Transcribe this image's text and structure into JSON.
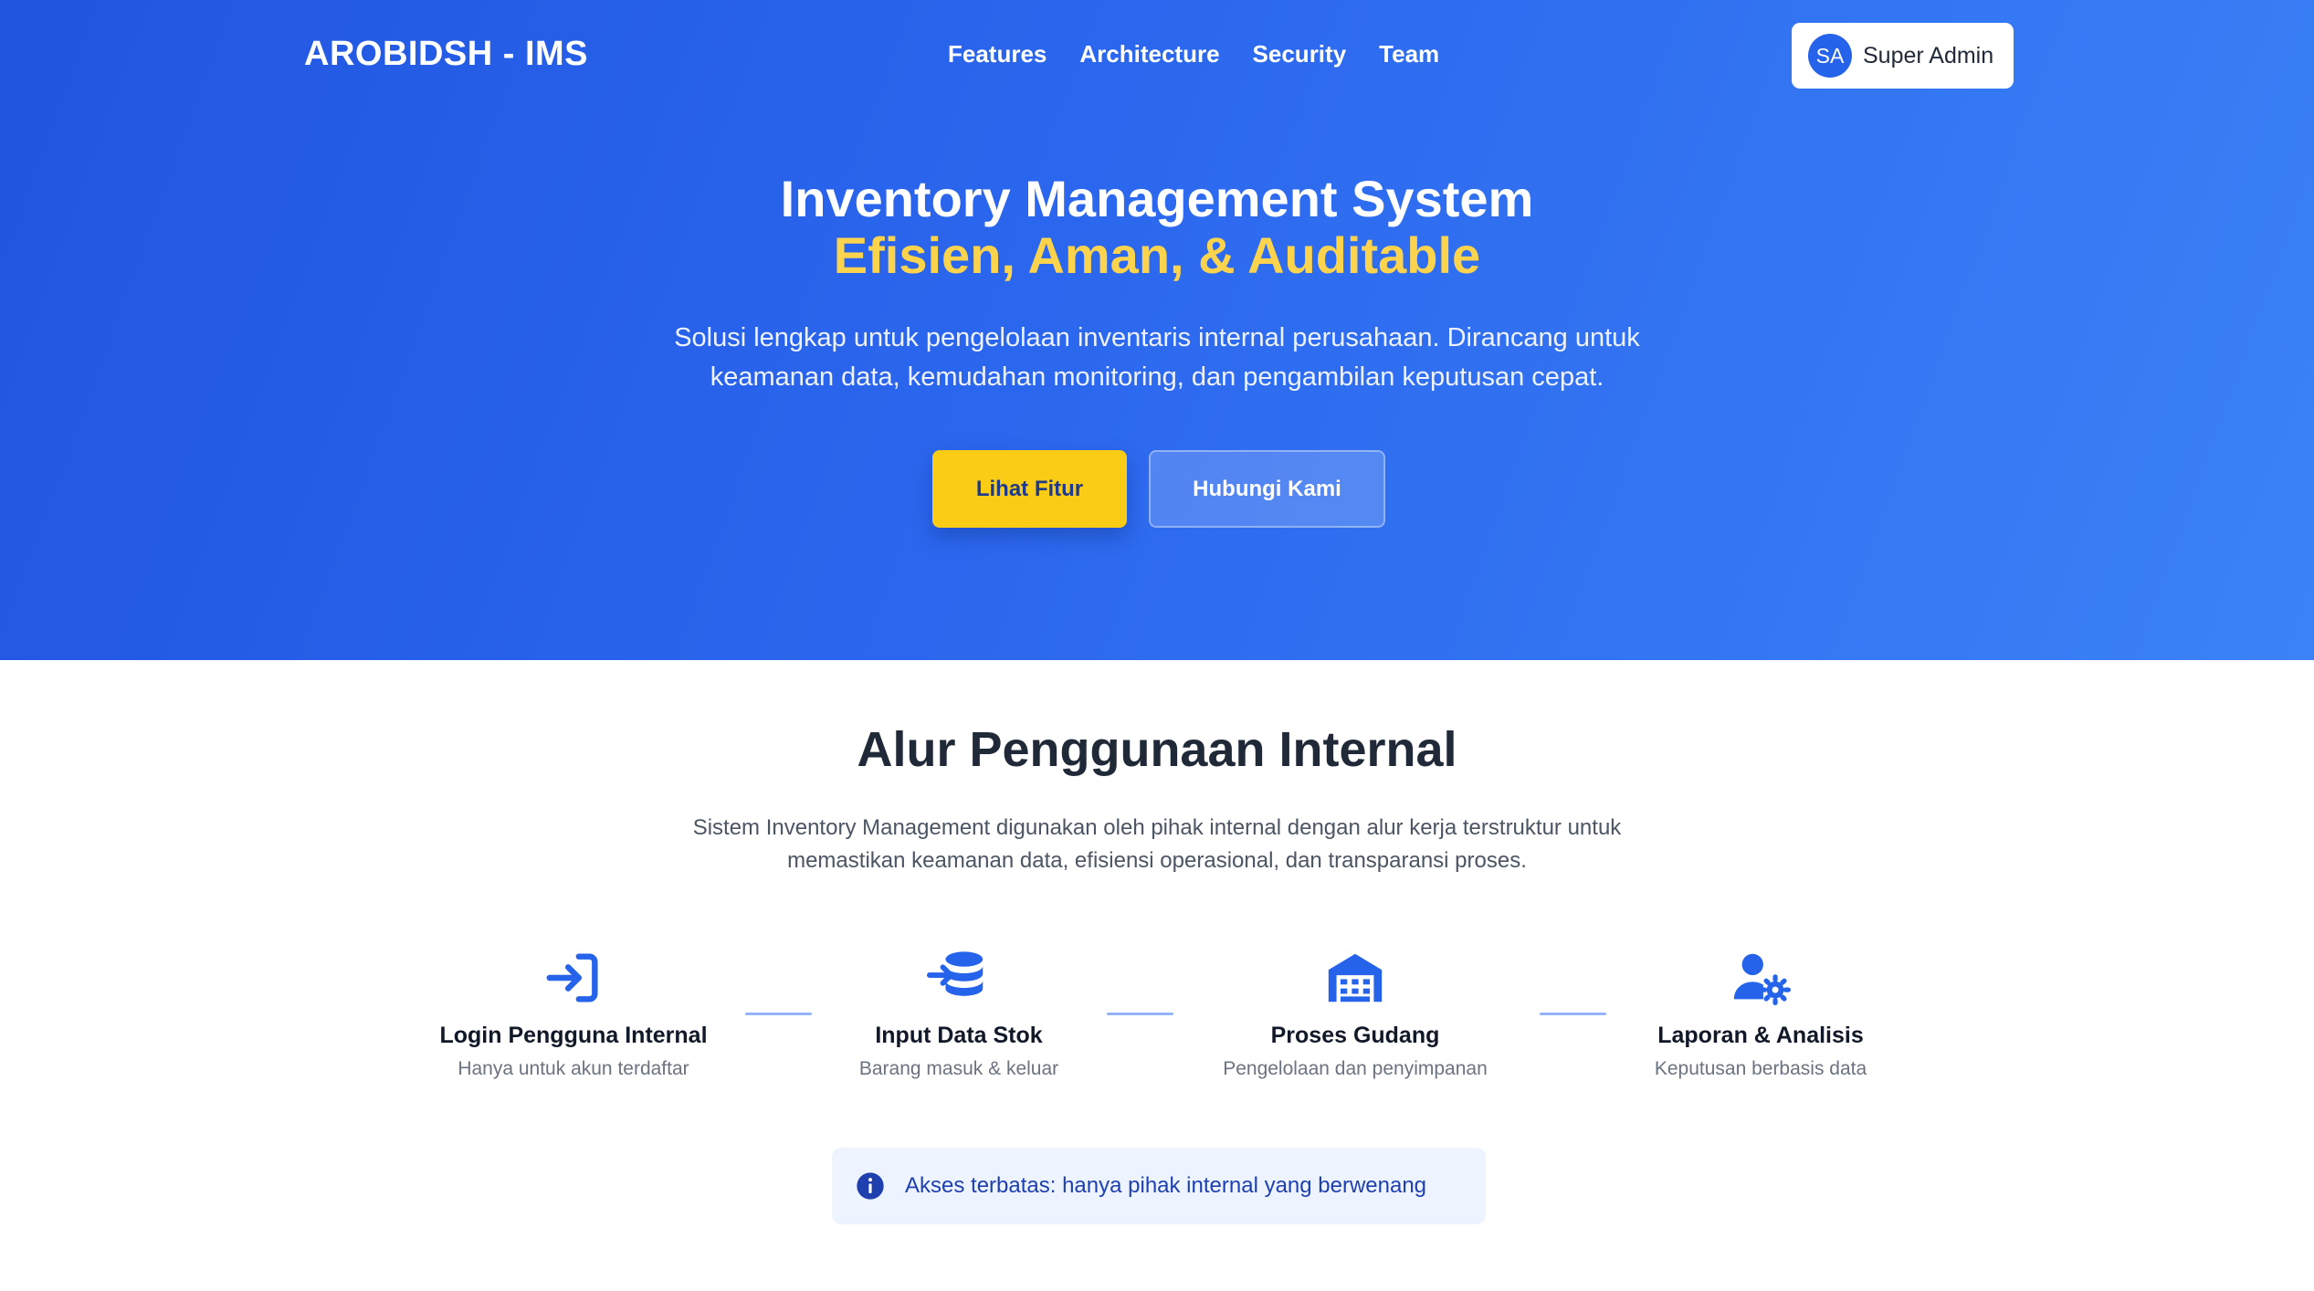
{
  "nav": {
    "brand": "AROBIDSH - IMS",
    "links": [
      "Features",
      "Architecture",
      "Security",
      "Team"
    ],
    "user": {
      "initials": "SA",
      "name": "Super Admin"
    }
  },
  "hero": {
    "title": "Inventory Management System",
    "title_accent": "Efisien, Aman, & Auditable",
    "description": "Solusi lengkap untuk pengelolaan inventaris internal perusahaan. Dirancang untuk keamanan data, kemudahan monitoring, dan pengambilan keputusan cepat.",
    "primary_button": "Lihat Fitur",
    "secondary_button": "Hubungi Kami"
  },
  "flow": {
    "title": "Alur Penggunaan Internal",
    "description": "Sistem Inventory Management digunakan oleh pihak internal dengan alur kerja terstruktur untuk memastikan keamanan data, efisiensi operasional, dan transparansi proses.",
    "steps": [
      {
        "icon": "login-icon",
        "title": "Login Pengguna Internal",
        "subtitle": "Hanya untuk akun terdaftar"
      },
      {
        "icon": "database-icon",
        "title": "Input Data Stok",
        "subtitle": "Barang masuk & keluar"
      },
      {
        "icon": "warehouse-icon",
        "title": "Proses Gudang",
        "subtitle": "Pengelolaan dan penyimpanan"
      },
      {
        "icon": "user-gear-icon",
        "title": "Laporan & Analisis",
        "subtitle": "Keputusan berbasis data"
      }
    ],
    "notice": "Akses terbatas: hanya pihak internal yang berwenang"
  },
  "colors": {
    "hero_gradient_start": "#2155e0",
    "hero_gradient_end": "#3b82f6",
    "accent_yellow": "#facc15",
    "title_accent_yellow": "#fcd34d",
    "icon_blue": "#2563eb"
  }
}
